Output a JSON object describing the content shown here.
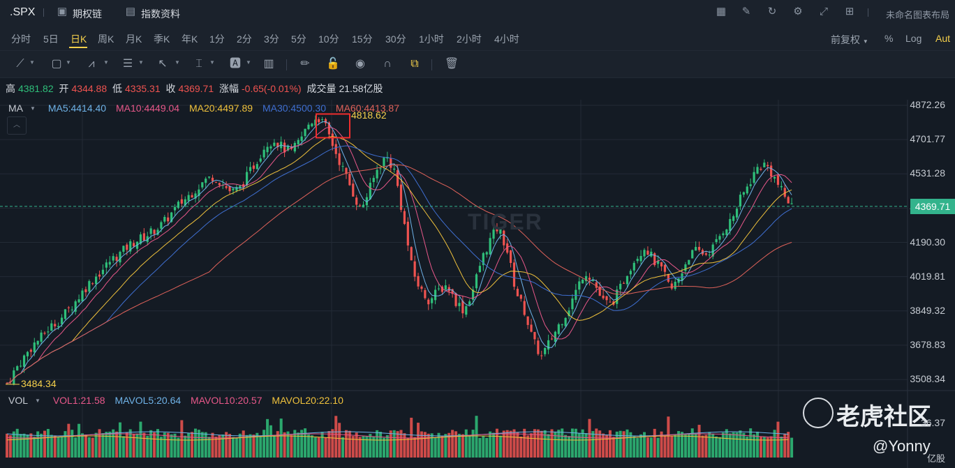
{
  "header": {
    "symbol": ".SPX",
    "option_chain": "期权链",
    "index_info": "指数资料",
    "layout_name": "未命名图表布局",
    "icons": [
      "chart-icon",
      "pen-icon",
      "refresh-icon",
      "settings-icon",
      "fullscreen-icon",
      "grid-icon"
    ]
  },
  "periods": {
    "items": [
      "分时",
      "5日",
      "日K",
      "周K",
      "月K",
      "季K",
      "年K",
      "1分",
      "2分",
      "3分",
      "5分",
      "10分",
      "15分",
      "30分",
      "1小时",
      "2小时",
      "4小时"
    ],
    "active": "日K",
    "adjust": "前复权",
    "percent": "%",
    "log": "Log",
    "auto": "Aut"
  },
  "ohlc": {
    "high_label": "高",
    "high": "4381.82",
    "open_label": "开",
    "open": "4344.88",
    "low_label": "低",
    "low": "4335.31",
    "close_label": "收",
    "close": "4369.71",
    "change_label": "涨幅",
    "change": "-0.65(-0.01%)",
    "volume_label": "成交量",
    "volume": "21.58亿股"
  },
  "ma": {
    "label": "MA",
    "ma5": "MA5:4414.40",
    "ma10": "MA10:4449.04",
    "ma20": "MA20:4497.89",
    "ma30": "MA30:4500.30",
    "ma60": "MA60:4413.87"
  },
  "vol": {
    "label": "VOL",
    "vol1": "VOL1:21.58",
    "mavol5": "MAVOL5:20.64",
    "mavol10": "MAVOL10:20.57",
    "mavol20": "MAVOL20:22.10",
    "axis_top": "36.37",
    "unit": "亿股"
  },
  "annotations": {
    "high": "4818.62",
    "low": "3484.34",
    "current": "4369.71"
  },
  "watermark": {
    "tiger": "TIGER",
    "brand": "老虎社区",
    "user": "@Yonny"
  },
  "colors": {
    "up": "#2fbf7a",
    "down": "#ef5350",
    "ma5": "#6fb3e8",
    "ma10": "#e8588a",
    "ma20": "#f0c23c",
    "ma30": "#3f6fd1",
    "ma60": "#e0625a",
    "highlight": "#f5d04b"
  },
  "chart_data": {
    "type": "line",
    "title": "",
    "y_ticks": [
      "4872.26",
      "4701.77",
      "4531.28",
      "4360.79",
      "4190.30",
      "4019.81",
      "3849.32",
      "3678.83",
      "3508.34"
    ],
    "ylim": [
      3460,
      4900
    ],
    "series": [
      {
        "name": "price",
        "values": [
          3490,
          3560,
          3620,
          3680,
          3720,
          3770,
          3800,
          3850,
          3900,
          3960,
          4010,
          4050,
          4100,
          4130,
          4170,
          4200,
          4220,
          4250,
          4280,
          4330,
          4380,
          4420,
          4460,
          4500,
          4520,
          4480,
          4440,
          4460,
          4530,
          4600,
          4680,
          4700,
          4660,
          4640,
          4700,
          4780,
          4818,
          4760,
          4650,
          4550,
          4450,
          4350,
          4450,
          4560,
          4620,
          4540,
          4300,
          4050,
          3950,
          3900,
          3950,
          3980,
          3900,
          3850,
          3950,
          4100,
          4200,
          4270,
          4150,
          3950,
          3850,
          3700,
          3620,
          3700,
          3780,
          3850,
          3950,
          4050,
          4000,
          3900,
          3880,
          3950,
          4050,
          4120,
          4170,
          4100,
          4050,
          3950,
          4020,
          4120,
          4150,
          4130,
          4170,
          4250,
          4300,
          4400,
          4480,
          4560,
          4580,
          4510,
          4430,
          4370
        ]
      }
    ],
    "high_marker": 4818.62,
    "low_marker": 3484.34,
    "current": 4369.71
  }
}
